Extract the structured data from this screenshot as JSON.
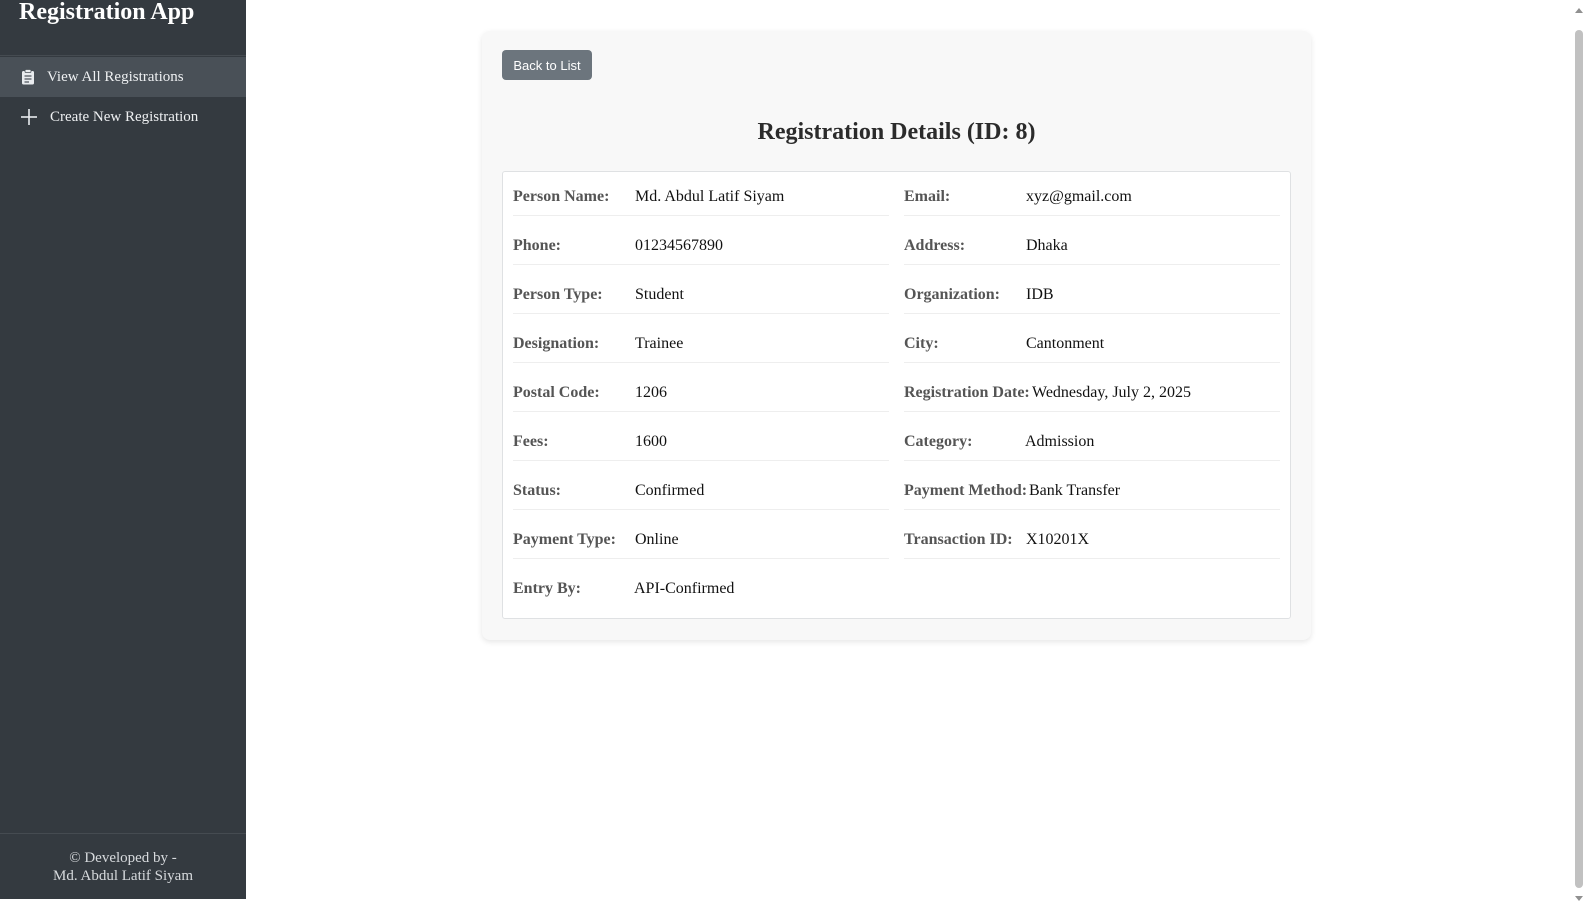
{
  "sidebar": {
    "title": "Registration App",
    "nav": [
      {
        "label": "View All Registrations",
        "icon": "clipboard-icon",
        "active": true
      },
      {
        "label": "Create New Registration",
        "icon": "plus-icon",
        "active": false
      }
    ],
    "footer_line1": "© Developed by -",
    "footer_line2": "Md. Abdul Latif Siyam"
  },
  "main": {
    "back_button": "Back to List",
    "title": "Registration Details (ID: 8)",
    "fields": {
      "person_name": {
        "label": "Person Name:",
        "value": "Md. Abdul Latif Siyam"
      },
      "email": {
        "label": "Email:",
        "value": "xyz@gmail.com"
      },
      "phone": {
        "label": "Phone:",
        "value": "01234567890"
      },
      "address": {
        "label": "Address:",
        "value": "Dhaka"
      },
      "person_type": {
        "label": "Person Type:",
        "value": "Student"
      },
      "organization": {
        "label": "Organization:",
        "value": "IDB"
      },
      "designation": {
        "label": "Designation:",
        "value": "Trainee"
      },
      "city": {
        "label": "City:",
        "value": "Cantonment"
      },
      "postal_code": {
        "label": "Postal Code:",
        "value": "1206"
      },
      "registration_date": {
        "label": "Registration Date:",
        "value": "Wednesday, July 2, 2025"
      },
      "fees": {
        "label": "Fees:",
        "value": "1600"
      },
      "category": {
        "label": "Category:",
        "value": "Admission"
      },
      "status": {
        "label": "Status:",
        "value": "Confirmed"
      },
      "payment_method": {
        "label": "Payment Method:",
        "value": "Bank Transfer"
      },
      "payment_type": {
        "label": "Payment Type:",
        "value": "Online"
      },
      "transaction_id": {
        "label": "Transaction ID:",
        "value": "X10201X"
      },
      "entry_by": {
        "label": "Entry By:",
        "value": "API-Confirmed"
      }
    }
  },
  "colors": {
    "sidebar_bg": "#343a40",
    "sidebar_active": "#495057",
    "button_bg": "#6c757d"
  }
}
